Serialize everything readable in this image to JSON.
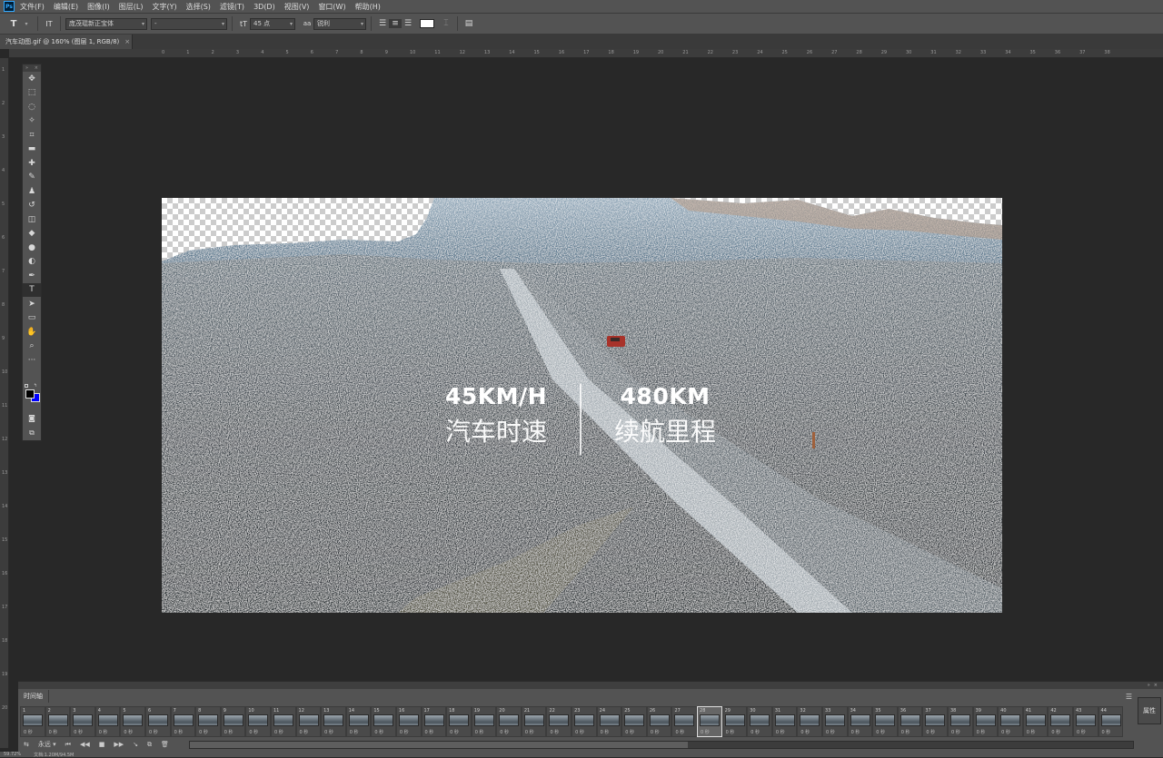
{
  "app": {
    "logo": "Ps"
  },
  "menu": {
    "items": [
      "文件(F)",
      "编辑(E)",
      "图像(I)",
      "图层(L)",
      "文字(Y)",
      "选择(S)",
      "滤镜(T)",
      "3D(D)",
      "视图(V)",
      "窗口(W)",
      "帮助(H)"
    ]
  },
  "options": {
    "tool_icon": "T",
    "orientation_icon": "IT",
    "font_family": "庞茂琨新正宝体",
    "font_style": "-",
    "size_icon": "tT",
    "font_size": "45 点",
    "aa_icon": "aa",
    "antialias": "锐利",
    "text_color": "#ffffff"
  },
  "document": {
    "tab_title": "汽车动图.gif @ 160% (图层 1, RGB/8)",
    "tab_close": "×"
  },
  "ruler": {
    "top_labels": [
      "0",
      "1",
      "2",
      "3",
      "4",
      "5",
      "6",
      "7",
      "8",
      "9",
      "10",
      "11",
      "12",
      "13",
      "14",
      "15",
      "16",
      "17",
      "18",
      "19",
      "20",
      "21",
      "22",
      "23",
      "24",
      "25",
      "26",
      "27",
      "28",
      "29",
      "30",
      "31",
      "32",
      "33",
      "34",
      "35",
      "36",
      "37",
      "38"
    ],
    "left_labels": [
      "1",
      "2",
      "3",
      "4",
      "5",
      "6",
      "7",
      "8",
      "9",
      "10",
      "11",
      "12",
      "13",
      "14",
      "15",
      "16",
      "17",
      "18",
      "19",
      "20"
    ]
  },
  "toolbar": {
    "tools": [
      {
        "name": "move-tool-icon",
        "glyph": "✥"
      },
      {
        "name": "marquee-tool-icon",
        "glyph": "⬚"
      },
      {
        "name": "lasso-tool-icon",
        "glyph": "◌"
      },
      {
        "name": "magic-wand-tool-icon",
        "glyph": "✧"
      },
      {
        "name": "crop-tool-icon",
        "glyph": "⌗"
      },
      {
        "name": "ruler-tool-icon",
        "glyph": "▬"
      },
      {
        "name": "healing-brush-tool-icon",
        "glyph": "✚"
      },
      {
        "name": "brush-tool-icon",
        "glyph": "✎"
      },
      {
        "name": "clone-stamp-tool-icon",
        "glyph": "♟"
      },
      {
        "name": "history-brush-tool-icon",
        "glyph": "↺"
      },
      {
        "name": "eraser-tool-icon",
        "glyph": "◫"
      },
      {
        "name": "paint-bucket-tool-icon",
        "glyph": "◆"
      },
      {
        "name": "blur-tool-icon",
        "glyph": "●"
      },
      {
        "name": "dodge-tool-icon",
        "glyph": "◐"
      },
      {
        "name": "pen-tool-icon",
        "glyph": "✒"
      },
      {
        "name": "type-tool-icon",
        "glyph": "T"
      },
      {
        "name": "path-selection-tool-icon",
        "glyph": "➤"
      },
      {
        "name": "shape-tool-icon",
        "glyph": "▭"
      },
      {
        "name": "hand-tool-icon",
        "glyph": "✋"
      },
      {
        "name": "zoom-tool-icon",
        "glyph": "⌕"
      },
      {
        "name": "more-tools-icon",
        "glyph": "···"
      }
    ],
    "active_tool": 15,
    "foreground_color": "#000000",
    "background_color": "#0000ff"
  },
  "canvas": {
    "stats": [
      {
        "value": "45KM/H",
        "label": "汽车时速"
      },
      {
        "value": "480KM",
        "label": "续航里程"
      }
    ]
  },
  "timeline": {
    "tab_label": "时间轴",
    "menu_icon": "☰",
    "frames": [
      {
        "n": "1",
        "d": "0 秒"
      },
      {
        "n": "2",
        "d": "0 秒"
      },
      {
        "n": "3",
        "d": "0 秒"
      },
      {
        "n": "4",
        "d": "0 秒"
      },
      {
        "n": "5",
        "d": "0 秒"
      },
      {
        "n": "6",
        "d": "0 秒"
      },
      {
        "n": "7",
        "d": "0 秒"
      },
      {
        "n": "8",
        "d": "0 秒"
      },
      {
        "n": "9",
        "d": "0 秒"
      },
      {
        "n": "10",
        "d": "0 秒"
      },
      {
        "n": "11",
        "d": "0 秒"
      },
      {
        "n": "12",
        "d": "0 秒"
      },
      {
        "n": "13",
        "d": "0 秒"
      },
      {
        "n": "14",
        "d": "0 秒"
      },
      {
        "n": "15",
        "d": "0 秒"
      },
      {
        "n": "16",
        "d": "0 秒"
      },
      {
        "n": "17",
        "d": "0 秒"
      },
      {
        "n": "18",
        "d": "0 秒"
      },
      {
        "n": "19",
        "d": "0 秒"
      },
      {
        "n": "20",
        "d": "0 秒"
      },
      {
        "n": "21",
        "d": "0 秒"
      },
      {
        "n": "22",
        "d": "0 秒"
      },
      {
        "n": "23",
        "d": "0 秒"
      },
      {
        "n": "24",
        "d": "0 秒"
      },
      {
        "n": "25",
        "d": "0 秒"
      },
      {
        "n": "26",
        "d": "0 秒"
      },
      {
        "n": "27",
        "d": "0 秒"
      },
      {
        "n": "28",
        "d": "0 秒"
      },
      {
        "n": "29",
        "d": "0 秒"
      },
      {
        "n": "30",
        "d": "0 秒"
      },
      {
        "n": "31",
        "d": "0 秒"
      },
      {
        "n": "32",
        "d": "0 秒"
      },
      {
        "n": "33",
        "d": "0 秒"
      },
      {
        "n": "34",
        "d": "0 秒"
      },
      {
        "n": "35",
        "d": "0 秒"
      },
      {
        "n": "36",
        "d": "0 秒"
      },
      {
        "n": "37",
        "d": "0 秒"
      },
      {
        "n": "38",
        "d": "0 秒"
      },
      {
        "n": "39",
        "d": "0 秒"
      },
      {
        "n": "40",
        "d": "0 秒"
      },
      {
        "n": "41",
        "d": "0 秒"
      },
      {
        "n": "42",
        "d": "0 秒"
      },
      {
        "n": "43",
        "d": "0 秒"
      },
      {
        "n": "44",
        "d": "0 秒"
      }
    ],
    "selected_frame": 27,
    "loop_label": "永远",
    "controls": [
      "⏮",
      "◀◀",
      "■",
      "▶▶"
    ],
    "properties_label": "属性"
  },
  "status": {
    "zoom": "59.72%",
    "doc_info": "文档:1.20M/94.5M"
  }
}
